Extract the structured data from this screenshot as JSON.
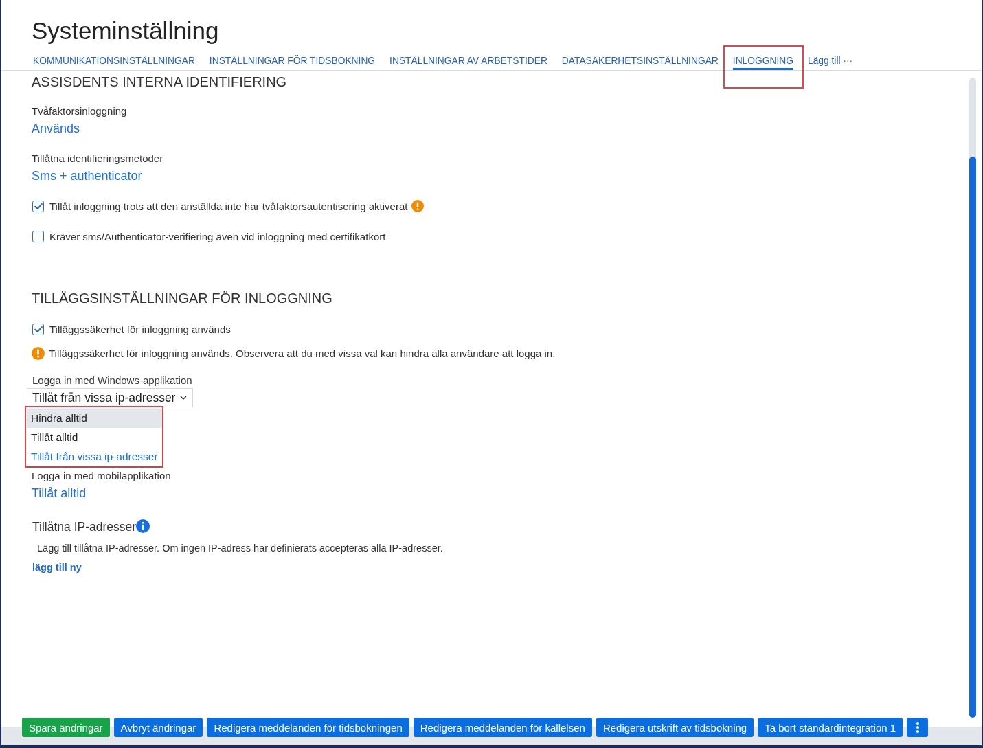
{
  "window": {
    "title": "Systeminställning"
  },
  "tabs": [
    {
      "label": "KOMMUNIKATIONSINSTÄLLNINGAR",
      "selected": false,
      "highlighted": false
    },
    {
      "label": "INSTÄLLNINGAR FÖR TIDSBOKNING",
      "selected": false,
      "highlighted": false
    },
    {
      "label": "INSTÄLLNINGAR AV ARBETSTIDER",
      "selected": false,
      "highlighted": false
    },
    {
      "label": "DATASÄKERHETSINSTÄLLNINGAR",
      "selected": false,
      "highlighted": false
    },
    {
      "label": "INLOGGNING",
      "selected": true,
      "highlighted": true
    }
  ],
  "tab_more": {
    "label": "Lägg till ···"
  },
  "sections": [
    {
      "heading": "ASSISDENTS INTERNA IDENTIFIERING",
      "items": [
        {
          "kind": "field",
          "label": "Tvåfaktorsinloggning",
          "value": "Används"
        },
        {
          "kind": "field",
          "label": "Tillåtna identifieringsmetoder",
          "value": "Sms + authenticator"
        },
        {
          "kind": "checkbox",
          "label": "Tillåt inloggning trots att den anställda inte har tvåfaktorsautentisering aktiverat",
          "checked": true,
          "warning": true
        },
        {
          "kind": "checkbox",
          "label": "Kräver sms/Authenticator-verifiering även vid inloggning med certifikatkort",
          "checked": false,
          "warning": false
        }
      ]
    },
    {
      "heading": "TILLÄGGSINSTÄLLNINGAR FÖR INLOGGNING",
      "items": [
        {
          "kind": "checkbox",
          "label": "Tilläggssäkerhet för inloggning används",
          "checked": true,
          "warning": false
        },
        {
          "kind": "notice",
          "text": "Tilläggssäkerhet för inloggning används. Observera att du med vissa val kan hindra alla användare att logga in."
        },
        {
          "kind": "select",
          "label": "Logga in med Windows-applikation",
          "value": "Tillåt från vissa ip-adresser",
          "expanded": true,
          "highlighted": true,
          "options": [
            {
              "label": "Hindra alltid",
              "hovered": true,
              "selected": false
            },
            {
              "label": "Tillåt alltid",
              "hovered": false,
              "selected": false
            },
            {
              "label": "Tillåt från vissa ip-adresser",
              "hovered": false,
              "selected": true
            }
          ]
        },
        {
          "kind": "field",
          "label": "Logga in med mobilapplikation",
          "value": "Tillåt alltid"
        },
        {
          "kind": "ip_list",
          "title": "Tillåtna IP-adresser",
          "info": true,
          "description": "Lägg till tillåtna IP-adresser. Om ingen IP-adress har definierats accepteras alla IP-adresser.",
          "add_link": "lägg till ny"
        }
      ]
    }
  ],
  "buttons": [
    {
      "kind": "primary",
      "label": "Spara ändringar"
    },
    {
      "kind": "secondary",
      "label": "Avbryt ändringar"
    },
    {
      "kind": "secondary",
      "label": "Redigera meddelanden för tidsbokningen"
    },
    {
      "kind": "secondary",
      "label": "Redigera meddelanden för kallelsen"
    },
    {
      "kind": "secondary",
      "label": "Redigera utskrift av tidsbokning"
    },
    {
      "kind": "secondary",
      "label": "Ta bort standardintegration 1"
    },
    {
      "kind": "more"
    }
  ]
}
